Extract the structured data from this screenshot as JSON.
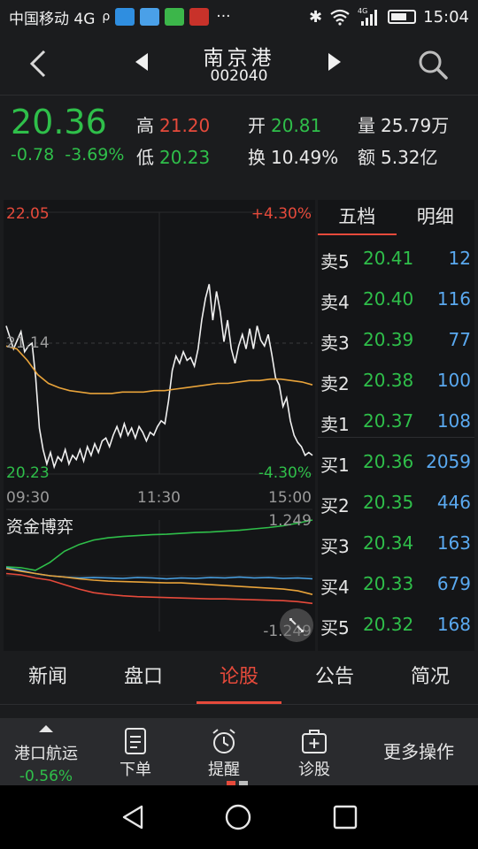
{
  "status_bar": {
    "carrier": "中国移动 4G",
    "network": "4G",
    "time": "15:04"
  },
  "header": {
    "stock_name": "南京港",
    "stock_code": "002040"
  },
  "quote": {
    "price": "20.36",
    "change": "-0.78",
    "change_pct": "-3.69%",
    "high_label": "高",
    "high": "21.20",
    "low_label": "低",
    "low": "20.23",
    "open_label": "开",
    "open": "20.81",
    "turnover_label": "换",
    "turnover": "10.49%",
    "volume_label": "量",
    "volume": "25.79万",
    "amount_label": "额",
    "amount": "5.32亿"
  },
  "chart_data": [
    {
      "type": "line",
      "y_max_label": "22.05",
      "y_mid_label": "21.14",
      "y_min_label": "20.23",
      "pct_max_label": "+4.30%",
      "pct_min_label": "-4.30%",
      "x_labels": [
        "09:30",
        "11:30",
        "15:00"
      ],
      "ylim": [
        20.23,
        22.05
      ],
      "series": [
        {
          "color": "#f0f0f0",
          "values": [
            21.26,
            21.18,
            21.1,
            21.16,
            21.22,
            21.08,
            21.12,
            21.14,
            20.9,
            20.55,
            20.4,
            20.3,
            20.38,
            20.28,
            20.35,
            20.32,
            20.4,
            20.3,
            20.36,
            20.33,
            20.4,
            20.32,
            20.42,
            20.36,
            20.44,
            20.38,
            20.46,
            20.48,
            20.42,
            20.5,
            20.56,
            20.49,
            20.58,
            20.5,
            20.55,
            20.48,
            20.56,
            20.52,
            20.46,
            20.52,
            20.5,
            20.56,
            20.6,
            20.58,
            20.74,
            20.95,
            21.05,
            21.0,
            21.08,
            21.02,
            21.04,
            20.98,
            21.1,
            21.3,
            21.45,
            21.55,
            21.3,
            21.5,
            21.36,
            21.15,
            21.3,
            21.1,
            21.0,
            21.12,
            21.2,
            21.1,
            21.24,
            21.1,
            21.26,
            21.16,
            21.12,
            21.2,
            21.06,
            20.9,
            20.85,
            20.7,
            20.76,
            20.6,
            20.5,
            20.45,
            20.42,
            20.36,
            20.38,
            20.36
          ]
        },
        {
          "color": "#e8a33a",
          "values": [
            21.12,
            21.1,
            21.02,
            20.92,
            20.86,
            20.83,
            20.81,
            20.8,
            20.79,
            20.79,
            20.79,
            20.8,
            20.8,
            20.8,
            20.81,
            20.81,
            20.82,
            20.83,
            20.84,
            20.85,
            20.86,
            20.86,
            20.87,
            20.88,
            20.88,
            20.89,
            20.89,
            20.88,
            20.87,
            20.85
          ]
        }
      ]
    },
    {
      "type": "line",
      "title": "资金博弈",
      "top_label": "1.249",
      "bottom_label": "-1.249",
      "ylim": [
        -1.249,
        1.249
      ],
      "series": [
        {
          "color": "#2fbf4a",
          "values": [
            0.2,
            0.18,
            0.12,
            0.3,
            0.55,
            0.7,
            0.8,
            0.85,
            0.88,
            0.9,
            0.92,
            0.93,
            0.95,
            0.97,
            0.98,
            1.0,
            1.02,
            1.05,
            1.08,
            1.12,
            1.18,
            1.249
          ]
        },
        {
          "color": "#4aa3e6",
          "values": [
            0.18,
            0.12,
            0.05,
            0.0,
            -0.03,
            -0.05,
            -0.04,
            -0.05,
            -0.06,
            -0.04,
            -0.05,
            -0.07,
            -0.05,
            -0.06,
            -0.04,
            -0.05,
            -0.03,
            -0.05,
            -0.04,
            -0.06,
            -0.05,
            -0.07
          ]
        },
        {
          "color": "#e8a33a",
          "values": [
            0.16,
            0.1,
            0.05,
            0.0,
            -0.03,
            -0.07,
            -0.1,
            -0.12,
            -0.13,
            -0.14,
            -0.15,
            -0.16,
            -0.16,
            -0.18,
            -0.2,
            -0.22,
            -0.24,
            -0.26,
            -0.28,
            -0.3,
            -0.34,
            -0.42
          ]
        },
        {
          "color": "#e64a3b",
          "values": [
            0.05,
            0.02,
            -0.05,
            -0.1,
            -0.2,
            -0.3,
            -0.38,
            -0.42,
            -0.45,
            -0.47,
            -0.48,
            -0.49,
            -0.5,
            -0.51,
            -0.52,
            -0.52,
            -0.53,
            -0.54,
            -0.55,
            -0.56,
            -0.58,
            -0.62
          ]
        }
      ]
    }
  ],
  "order_book": {
    "tabs": [
      "五档",
      "明细"
    ],
    "asks": [
      {
        "label": "卖5",
        "price": "20.41",
        "volume": "12"
      },
      {
        "label": "卖4",
        "price": "20.40",
        "volume": "116"
      },
      {
        "label": "卖3",
        "price": "20.39",
        "volume": "77"
      },
      {
        "label": "卖2",
        "price": "20.38",
        "volume": "100"
      },
      {
        "label": "卖1",
        "price": "20.37",
        "volume": "108"
      }
    ],
    "bids": [
      {
        "label": "买1",
        "price": "20.36",
        "volume": "2059"
      },
      {
        "label": "买2",
        "price": "20.35",
        "volume": "446"
      },
      {
        "label": "买3",
        "price": "20.34",
        "volume": "163"
      },
      {
        "label": "买4",
        "price": "20.33",
        "volume": "679"
      },
      {
        "label": "买5",
        "price": "20.32",
        "volume": "168"
      }
    ]
  },
  "tabs": [
    "新闻",
    "盘口",
    "论股",
    "公告",
    "简况"
  ],
  "actions": {
    "sector_name": "港口航运",
    "sector_change": "-0.56%",
    "order": "下单",
    "alert": "提醒",
    "diagnose": "诊股",
    "more": "更多操作"
  }
}
